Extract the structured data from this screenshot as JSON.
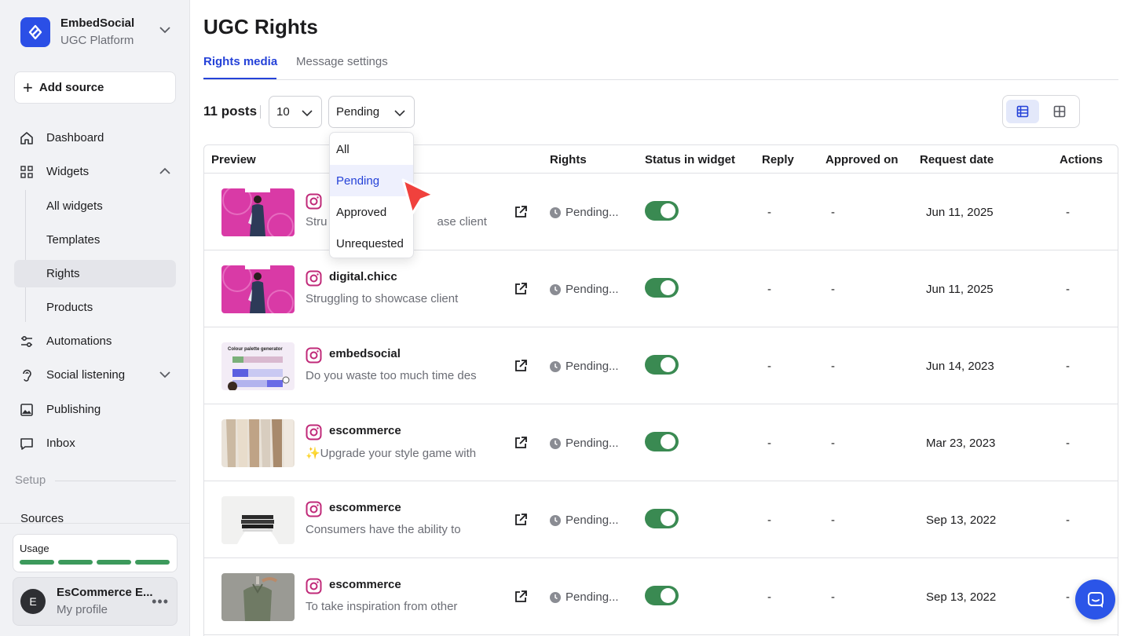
{
  "brand": {
    "name": "EmbedSocial",
    "subtitle": "UGC Platform"
  },
  "sidebar": {
    "add_source": "Add source",
    "nav": {
      "dashboard": "Dashboard",
      "widgets": "Widgets",
      "all_widgets": "All widgets",
      "templates": "Templates",
      "rights": "Rights",
      "products": "Products",
      "automations": "Automations",
      "social_listening": "Social listening",
      "publishing": "Publishing",
      "inbox": "Inbox",
      "sources": "Sources"
    },
    "setup_label": "Setup",
    "usage": {
      "title": "Usage",
      "segments": 4
    },
    "profile": {
      "initial": "E",
      "name": "EsCommerce E...",
      "subtitle": "My profile"
    }
  },
  "page": {
    "title": "UGC Rights",
    "tabs": [
      {
        "label": "Rights media",
        "active": true
      },
      {
        "label": "Message settings",
        "active": false
      }
    ]
  },
  "toolbar": {
    "posts_count": "11 posts",
    "per_page": "10",
    "status_filter": "Pending"
  },
  "dropdown": {
    "options": [
      "All",
      "Pending",
      "Approved",
      "Unrequested"
    ],
    "selected": "Pending"
  },
  "table": {
    "headers": {
      "preview": "Preview",
      "rights": "Rights",
      "status_in_widget": "Status in widget",
      "reply": "Reply",
      "approved_on": "Approved on",
      "request_date": "Request date",
      "actions": "Actions"
    },
    "rows": [
      {
        "author": "",
        "caption": "Stru",
        "caption_tail": "ase client",
        "rights": "Pending...",
        "status_on": true,
        "reply": "-",
        "approved_on": "-",
        "request_date": "Jun 11, 2025",
        "actions": "-"
      },
      {
        "author": "digital.chicc",
        "caption": "Struggling to showcase client",
        "rights": "Pending...",
        "status_on": true,
        "reply": "-",
        "approved_on": "-",
        "request_date": "Jun 11, 2025",
        "actions": "-"
      },
      {
        "author": "embedsocial",
        "caption": "Do you waste too much time des",
        "rights": "Pending...",
        "status_on": true,
        "reply": "-",
        "approved_on": "-",
        "request_date": "Jun 14, 2023",
        "actions": "-"
      },
      {
        "author": "escommerce",
        "caption": "✨Upgrade your style game with",
        "rights": "Pending...",
        "status_on": true,
        "reply": "-",
        "approved_on": "-",
        "request_date": "Mar 23, 2023",
        "actions": "-"
      },
      {
        "author": "escommerce",
        "caption": "Consumers have the ability to",
        "rights": "Pending...",
        "status_on": true,
        "reply": "-",
        "approved_on": "-",
        "request_date": "Sep 13, 2022",
        "actions": "-"
      },
      {
        "author": "escommerce",
        "caption": "To take inspiration from other",
        "rights": "Pending...",
        "status_on": true,
        "reply": "-",
        "approved_on": "-",
        "request_date": "Sep 13, 2022",
        "actions": "-"
      }
    ],
    "thumb_text": "Colour palette generator"
  },
  "colors": {
    "accent": "#2542d8",
    "brand": "#2b4fe6",
    "toggle_on": "#3a8a52",
    "usage": "#3d9a5c",
    "cursor": "#f0413d"
  }
}
